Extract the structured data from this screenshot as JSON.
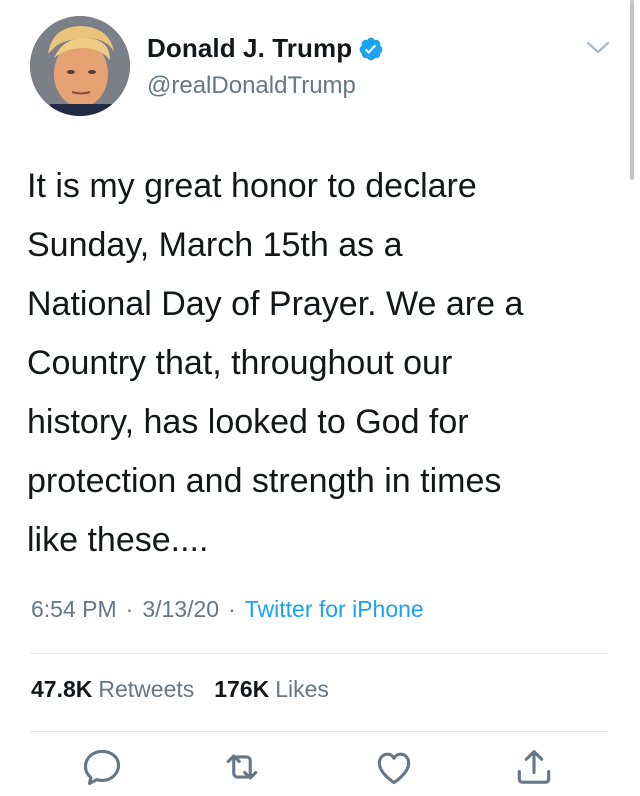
{
  "author": {
    "display_name": "Donald J. Trump",
    "handle": "@realDonaldTrump",
    "verified": true,
    "avatar_icon": "profile-photo"
  },
  "tweet": {
    "lines": [
      "It is my great honor to declare",
      "Sunday, March 15th as a",
      "National Day of Prayer. We are a",
      "Country that, throughout our",
      "history, has looked to God for",
      "protection and strength in times",
      "like these...."
    ]
  },
  "meta": {
    "time": "6:54 PM",
    "date": "3/13/20",
    "separator": "·",
    "source": "Twitter for iPhone"
  },
  "stats": {
    "retweets_count": "47.8K",
    "retweets_label": "Retweets",
    "likes_count": "176K",
    "likes_label": "Likes"
  },
  "actions": {
    "reply_icon": "reply-icon",
    "retweet_icon": "retweet-icon",
    "like_icon": "heart-icon",
    "share_icon": "share-icon"
  },
  "colors": {
    "verified_blue": "#1da1f2",
    "link_blue": "#1da1f2",
    "muted_gray": "#657786",
    "divider": "#e1e8ed"
  }
}
